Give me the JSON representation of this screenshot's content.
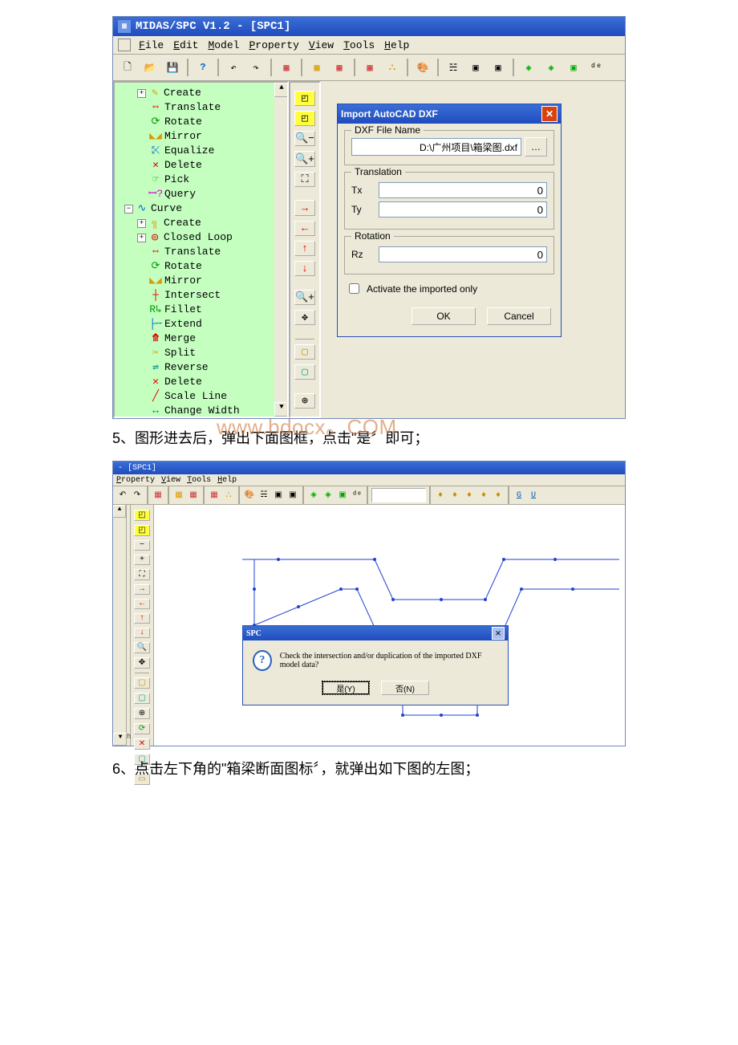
{
  "watermark": "www.bdocx。COM",
  "shot1": {
    "title": "MIDAS/SPC V1.2 - [SPC1]",
    "menus": [
      "File",
      "Edit",
      "Model",
      "Property",
      "View",
      "Tools",
      "Help"
    ],
    "tree": {
      "group1_label": "Curve",
      "items_top": [
        {
          "label": "Create",
          "expander": "＋",
          "icon": "create-icon"
        },
        {
          "label": "Translate",
          "icon": "translate-icon"
        },
        {
          "label": "Rotate",
          "icon": "rotate-icon"
        },
        {
          "label": "Mirror",
          "icon": "mirror-icon"
        },
        {
          "label": "Equalize",
          "icon": "equalize-icon"
        },
        {
          "label": "Delete",
          "icon": "delete-icon"
        },
        {
          "label": "Pick",
          "icon": "pick-icon"
        },
        {
          "label": "Query",
          "icon": "query-icon"
        }
      ],
      "items_curve": [
        {
          "label": "Create",
          "expander": "＋",
          "icon": "create-icon"
        },
        {
          "label": "Closed Loop",
          "expander": "＋",
          "icon": "closed-loop-icon"
        },
        {
          "label": "Translate",
          "icon": "translate-icon"
        },
        {
          "label": "Rotate",
          "icon": "rotate-icon"
        },
        {
          "label": "Mirror",
          "icon": "mirror-icon"
        },
        {
          "label": "Intersect",
          "icon": "intersect-icon"
        },
        {
          "label": "Fillet",
          "icon": "fillet-icon"
        },
        {
          "label": "Extend",
          "icon": "extend-icon"
        },
        {
          "label": "Merge",
          "icon": "merge-icon"
        },
        {
          "label": "Split",
          "icon": "split-icon"
        },
        {
          "label": "Reverse",
          "icon": "reverse-icon"
        },
        {
          "label": "Delete",
          "icon": "delete-icon"
        },
        {
          "label": "Scale Line",
          "icon": "scale-line-icon"
        },
        {
          "label": "Change Width",
          "icon": "change-width-icon"
        }
      ]
    },
    "dialog": {
      "title": "Import AutoCAD DXF",
      "file_group": "DXF File Name",
      "file_value": "D:\\广州项目\\箱梁图.dxf",
      "translation_group": "Translation",
      "tx_label": "Tx",
      "tx_value": "0",
      "ty_label": "Ty",
      "ty_value": "0",
      "rotation_group": "Rotation",
      "rz_label": "Rz",
      "rz_value": "0",
      "activate_label": "Activate the imported only",
      "ok": "OK",
      "cancel": "Cancel"
    }
  },
  "para1": "5、图形进去后，弹出下面图框，点击\"是〞即可；",
  "shot2": {
    "title": "- [SPC1]",
    "menus": [
      "Property",
      "View",
      "Tools",
      "Help"
    ],
    "left_label": "h",
    "msg": {
      "title": "SPC",
      "text": "Check the intersection and/or duplication of the imported DXF model data?",
      "yes": "是(Y)",
      "no": "否(N)"
    }
  },
  "para2": "6、点击左下角的\"箱梁断面图标〞，就弹出如下图的左图；"
}
